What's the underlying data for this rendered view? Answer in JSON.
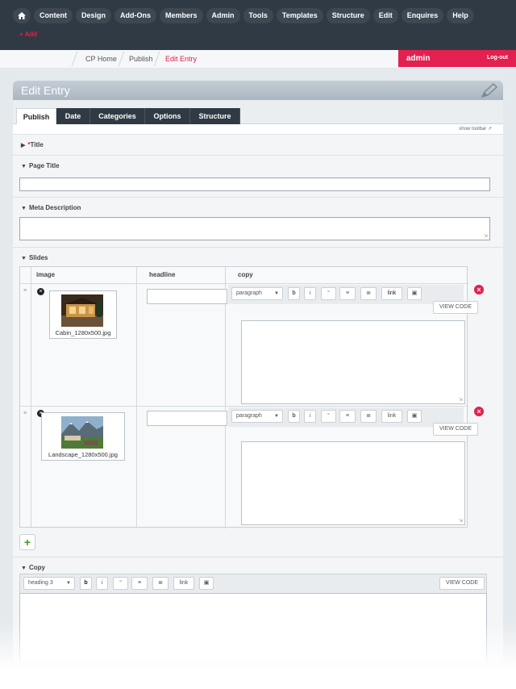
{
  "nav": {
    "items": [
      "Content",
      "Design",
      "Add-Ons",
      "Members",
      "Admin",
      "Tools",
      "Templates",
      "Structure",
      "Edit",
      "Enquires",
      "Help"
    ],
    "add_label": "+ Add",
    "home_icon": "home-icon"
  },
  "breadcrumb": {
    "items": [
      "CP Home",
      "Publish",
      "Edit Entry"
    ]
  },
  "user": {
    "name": "admin",
    "logout_label": "Log-out"
  },
  "panel": {
    "title": "Edit Entry",
    "tabs": [
      "Publish",
      "Date",
      "Categories",
      "Options",
      "Structure"
    ],
    "active_tab": "Publish",
    "show_toolbar_label": "show toolbar"
  },
  "fields": {
    "title": {
      "required_mark": "*",
      "label": "Title"
    },
    "page_title": {
      "label": "Page Title",
      "value": ""
    },
    "meta_description": {
      "label": "Meta Description",
      "value": ""
    },
    "slides": {
      "label": "Slides",
      "columns": [
        "image",
        "headline",
        "copy"
      ],
      "rows": [
        {
          "image_caption": "Cabin_1280x500.jpg",
          "headline": "",
          "copy": ""
        },
        {
          "image_caption": "Landscape_1280x500.jpg",
          "headline": "",
          "copy": ""
        }
      ],
      "toolbar": {
        "format": "paragraph",
        "bold": "b",
        "italic": "i",
        "quote": "“",
        "link": "link",
        "view_code": "VIEW CODE"
      }
    },
    "copy": {
      "label": "Copy",
      "toolbar": {
        "format": "heading 3",
        "bold": "b",
        "italic": "i",
        "quote": "“",
        "link": "link",
        "view_code": "VIEW CODE"
      }
    }
  },
  "colors": {
    "nav_bg": "#2f3a44",
    "accent": "#e3204f",
    "add_green": "#3a9d23"
  }
}
